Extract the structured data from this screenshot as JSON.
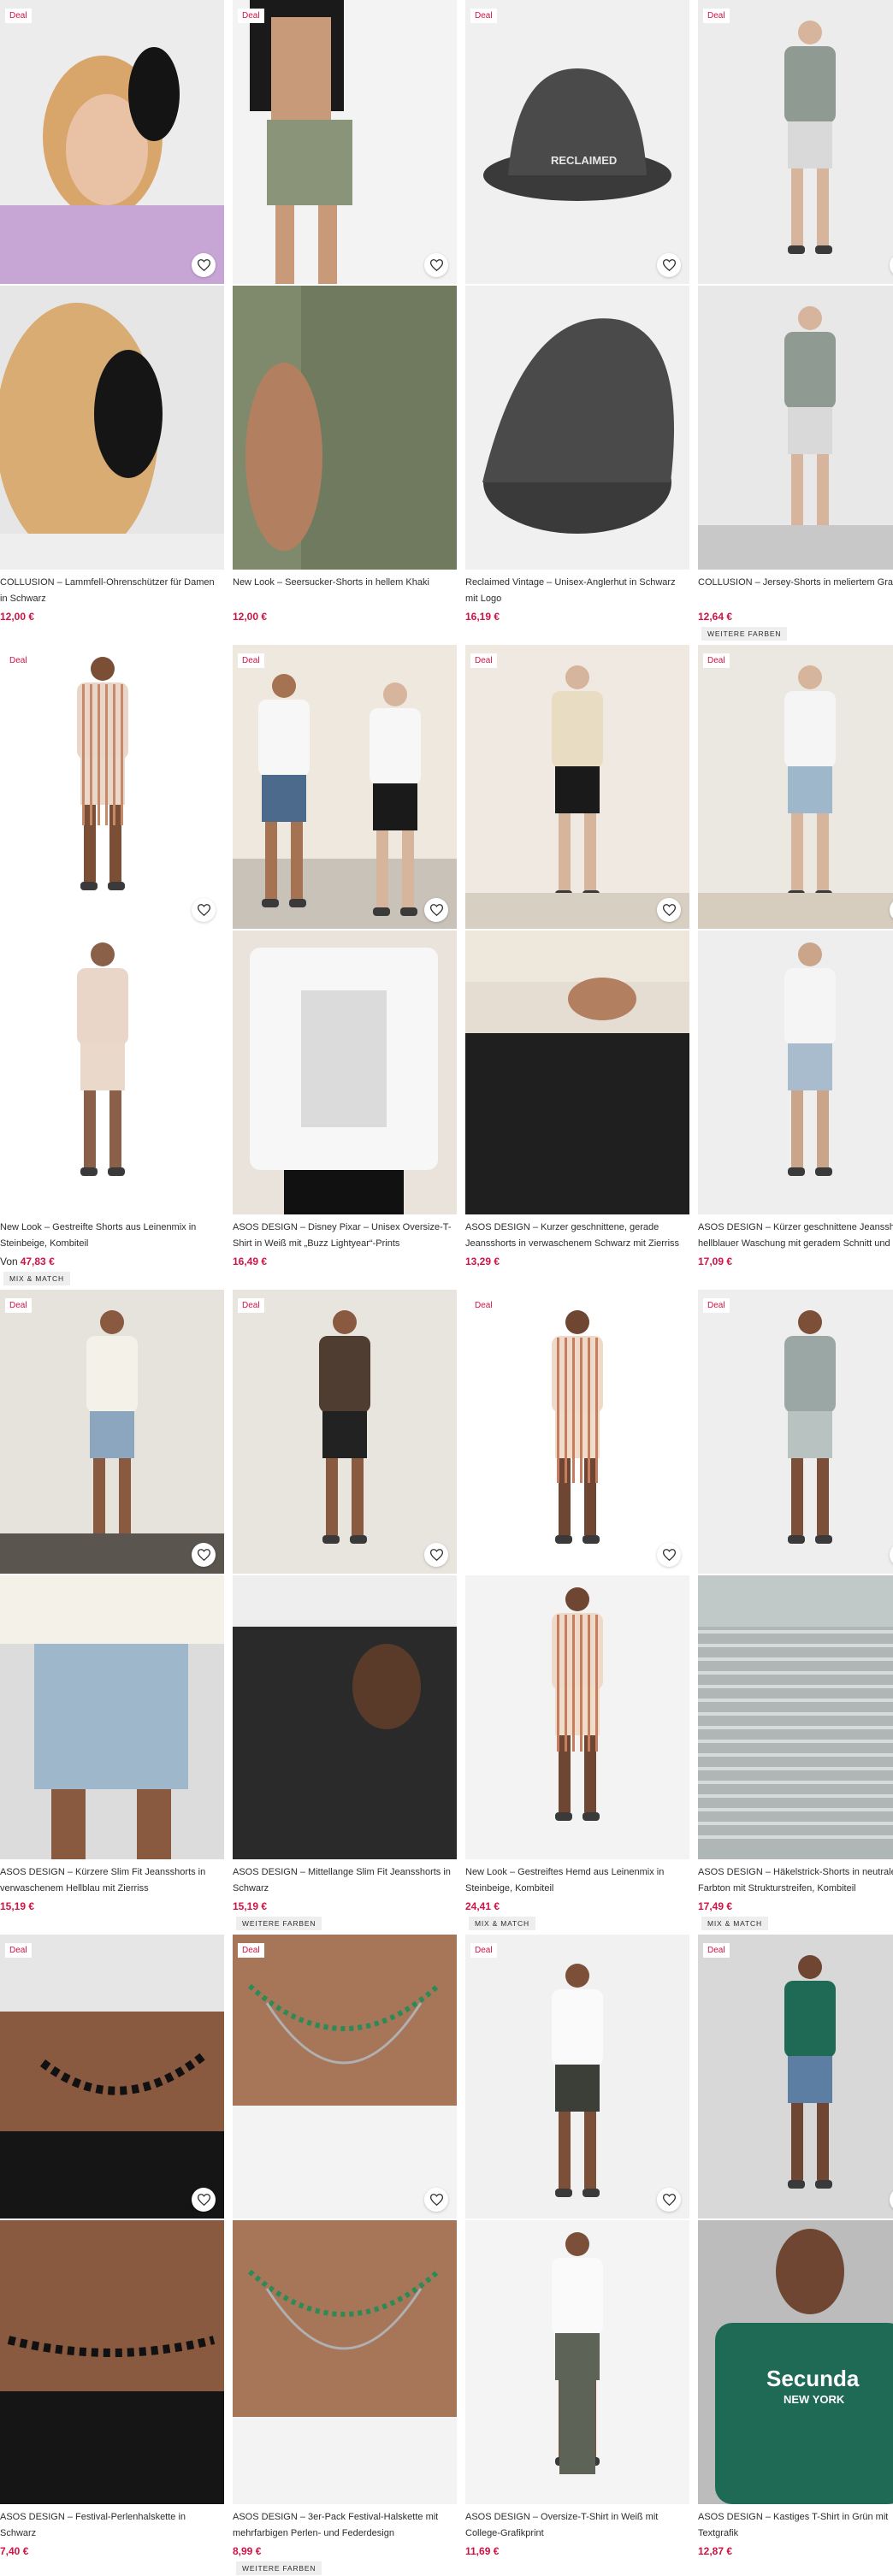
{
  "deal_label": "Deal",
  "colors": {
    "price": "#d01345",
    "text": "#2d2d2d",
    "tag_bg": "#eeeeee"
  },
  "wishlist_icon": "heart-icon",
  "products": [
    {
      "title": "COLLUSION – Lammfell-Ohrenschützer für Damen in Schwarz",
      "price": "12,00 €",
      "tag": "",
      "deal": true
    },
    {
      "title": "New Look – Seersucker-Shorts in hellem Khaki",
      "price": "12,00 €",
      "tag": "",
      "deal": true
    },
    {
      "title": "Reclaimed Vintage – Unisex-Anglerhut in Schwarz mit Logo",
      "price": "16,19 €",
      "tag": "",
      "deal": true
    },
    {
      "title": "COLLUSION – Jersey-Shorts in meliertem Grau",
      "price": "12,64 €",
      "tag": "WEITERE FARBEN",
      "deal": true
    },
    {
      "title": "New Look – Gestreifte Shorts aus Leinenmix in Steinbeige, Kombiteil",
      "price_prefix": "Von",
      "price": "47,83 €",
      "tag": "MIX & MATCH",
      "deal": true
    },
    {
      "title": "ASOS DESIGN – Disney Pixar – Unisex Oversize-T-Shirt in Weiß mit „Buzz Lightyear“-Prints",
      "price": "16,49 €",
      "tag": "",
      "deal": true
    },
    {
      "title": "ASOS DESIGN – Kurzer geschnittene, gerade Jeansshorts in verwaschenem Schwarz mit Zierriss",
      "price": "13,29 €",
      "tag": "",
      "deal": true
    },
    {
      "title": "ASOS DESIGN – Kürzer geschnittene Jeansshorts in hellblauer Waschung mit geradem Schnitt und Zierriss",
      "price": "17,09 €",
      "tag": "",
      "deal": true
    },
    {
      "title": "ASOS DESIGN – Kürzere Slim Fit Jeansshorts in verwaschenem Hellblau mit Zierriss",
      "price": "15,19 €",
      "tag": "",
      "deal": true
    },
    {
      "title": "ASOS DESIGN – Mittellange Slim Fit Jeansshorts in Schwarz",
      "price": "15,19 €",
      "tag": "WEITERE FARBEN",
      "deal": true
    },
    {
      "title": "New Look – Gestreiftes Hemd aus Leinenmix in Steinbeige, Kombiteil",
      "price": "24,41 €",
      "tag": "MIX & MATCH",
      "deal": true
    },
    {
      "title": "ASOS DESIGN – Häkelstrick-Shorts in neutralem Farbton mit Strukturstreifen, Kombiteil",
      "price": "17,49 €",
      "tag": "MIX & MATCH",
      "deal": true
    },
    {
      "title": "ASOS DESIGN – Festival-Perlenhalskette in Schwarz",
      "price": "7,40 €",
      "tag": "",
      "deal": true
    },
    {
      "title": "ASOS DESIGN – 3er-Pack Festival-Halskette mit mehrfarbigen Perlen- und Federdesign",
      "price": "8,99 €",
      "tag": "WEITERE FARBEN",
      "deal": true
    },
    {
      "title": "ASOS DESIGN – Oversize-T-Shirt in Weiß mit College-Grafikprint",
      "price": "11,69 €",
      "tag": "",
      "deal": true
    },
    {
      "title": "ASOS DESIGN – Kastiges T-Shirt in Grün mit Textgrafik",
      "price": "12,87 €",
      "tag": "",
      "deal": true
    }
  ],
  "image_text": {
    "hat_logo": "RECLAIMED",
    "tshirt_green_front": "Secunda",
    "tshirt_green_sub": "NEW YORK"
  }
}
